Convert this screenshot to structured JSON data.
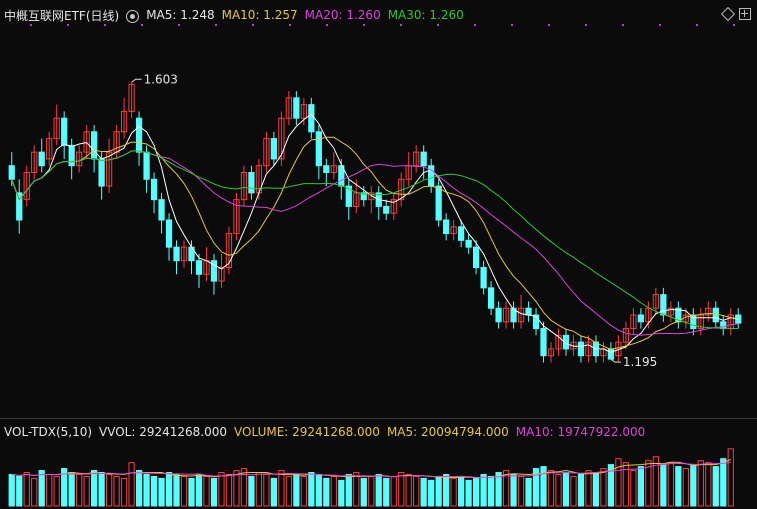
{
  "header": {
    "title": "中概互联网ETF(日线)",
    "ma5": "MA5: 1.248",
    "ma10": "MA10: 1.257",
    "ma20": "MA20: 1.260",
    "ma30": "MA30: 1.260"
  },
  "volume_header": {
    "title": "VOL-TDX(5,10)",
    "vvol": "VVOL: 29241268.000",
    "volume": "VOLUME: 29241268.000",
    "ma5": "MA5: 20094794.000",
    "ma10": "MA10: 19747922.000"
  },
  "annotations": {
    "high": "1.603",
    "low": "1.195"
  },
  "colors": {
    "up": "#ff3b3b",
    "down": "#54ffff",
    "ma5": "#ffffff",
    "ma10": "#e8c832",
    "ma20": "#e040e0",
    "ma30": "#2ec82e"
  },
  "icons": [
    "settings-gear-icon",
    "diamond-icon",
    "add-panel-icon"
  ],
  "chart_data": [
    {
      "type": "candlestick",
      "price_range": [
        1.12,
        1.68
      ],
      "high_label": 1.603,
      "low_label": 1.195,
      "candles": [
        [
          1.48,
          1.46,
          1.5,
          1.45
        ],
        [
          1.44,
          1.4,
          1.46,
          1.38
        ],
        [
          1.43,
          1.47,
          1.48,
          1.42
        ],
        [
          1.47,
          1.5,
          1.51,
          1.46
        ],
        [
          1.5,
          1.48,
          1.52,
          1.47
        ],
        [
          1.49,
          1.52,
          1.53,
          1.48
        ],
        [
          1.52,
          1.55,
          1.57,
          1.51
        ],
        [
          1.55,
          1.51,
          1.56,
          1.49
        ],
        [
          1.51,
          1.48,
          1.52,
          1.46
        ],
        [
          1.48,
          1.5,
          1.51,
          1.47
        ],
        [
          1.5,
          1.53,
          1.54,
          1.49
        ],
        [
          1.53,
          1.49,
          1.54,
          1.47
        ],
        [
          1.49,
          1.45,
          1.5,
          1.43
        ],
        [
          1.45,
          1.5,
          1.52,
          1.44
        ],
        [
          1.5,
          1.53,
          1.54,
          1.49
        ],
        [
          1.53,
          1.56,
          1.58,
          1.52
        ],
        [
          1.56,
          1.6,
          1.603,
          1.55
        ],
        [
          1.55,
          1.5,
          1.56,
          1.48
        ],
        [
          1.5,
          1.46,
          1.51,
          1.44
        ],
        [
          1.46,
          1.43,
          1.47,
          1.41
        ],
        [
          1.43,
          1.4,
          1.44,
          1.38
        ],
        [
          1.4,
          1.36,
          1.41,
          1.34
        ],
        [
          1.36,
          1.34,
          1.37,
          1.32
        ],
        [
          1.34,
          1.36,
          1.37,
          1.33
        ],
        [
          1.36,
          1.34,
          1.37,
          1.32
        ],
        [
          1.34,
          1.32,
          1.35,
          1.3
        ],
        [
          1.32,
          1.34,
          1.36,
          1.31
        ],
        [
          1.34,
          1.31,
          1.35,
          1.29
        ],
        [
          1.31,
          1.33,
          1.35,
          1.3
        ],
        [
          1.33,
          1.38,
          1.39,
          1.32
        ],
        [
          1.38,
          1.43,
          1.44,
          1.37
        ],
        [
          1.43,
          1.47,
          1.48,
          1.42
        ],
        [
          1.47,
          1.44,
          1.48,
          1.43
        ],
        [
          1.44,
          1.48,
          1.49,
          1.43
        ],
        [
          1.48,
          1.52,
          1.53,
          1.47
        ],
        [
          1.52,
          1.49,
          1.53,
          1.48
        ],
        [
          1.49,
          1.55,
          1.56,
          1.48
        ],
        [
          1.55,
          1.58,
          1.59,
          1.54
        ],
        [
          1.58,
          1.55,
          1.59,
          1.54
        ],
        [
          1.55,
          1.57,
          1.58,
          1.54
        ],
        [
          1.57,
          1.53,
          1.58,
          1.52
        ],
        [
          1.53,
          1.48,
          1.54,
          1.46
        ],
        [
          1.48,
          1.47,
          1.49,
          1.45
        ],
        [
          1.47,
          1.48,
          1.5,
          1.46
        ],
        [
          1.48,
          1.45,
          1.49,
          1.43
        ],
        [
          1.45,
          1.42,
          1.46,
          1.4
        ],
        [
          1.42,
          1.44,
          1.46,
          1.41
        ],
        [
          1.44,
          1.43,
          1.45,
          1.42
        ],
        [
          1.43,
          1.44,
          1.45,
          1.41
        ],
        [
          1.44,
          1.42,
          1.45,
          1.4
        ],
        [
          1.42,
          1.41,
          1.43,
          1.4
        ],
        [
          1.41,
          1.43,
          1.44,
          1.4
        ],
        [
          1.43,
          1.46,
          1.47,
          1.42
        ],
        [
          1.46,
          1.48,
          1.5,
          1.45
        ],
        [
          1.48,
          1.5,
          1.51,
          1.47
        ],
        [
          1.5,
          1.48,
          1.51,
          1.46
        ],
        [
          1.48,
          1.45,
          1.49,
          1.44
        ],
        [
          1.45,
          1.4,
          1.46,
          1.39
        ],
        [
          1.4,
          1.38,
          1.41,
          1.37
        ],
        [
          1.38,
          1.39,
          1.4,
          1.37
        ],
        [
          1.39,
          1.37,
          1.4,
          1.36
        ],
        [
          1.37,
          1.36,
          1.38,
          1.35
        ],
        [
          1.36,
          1.33,
          1.37,
          1.32
        ],
        [
          1.33,
          1.3,
          1.34,
          1.29
        ],
        [
          1.3,
          1.27,
          1.31,
          1.26
        ],
        [
          1.27,
          1.25,
          1.28,
          1.24
        ],
        [
          1.25,
          1.27,
          1.28,
          1.24
        ],
        [
          1.27,
          1.25,
          1.28,
          1.24
        ],
        [
          1.25,
          1.27,
          1.29,
          1.24
        ],
        [
          1.27,
          1.26,
          1.28,
          1.25
        ],
        [
          1.26,
          1.24,
          1.27,
          1.23
        ],
        [
          1.24,
          1.2,
          1.25,
          1.19
        ],
        [
          1.2,
          1.21,
          1.22,
          1.19
        ],
        [
          1.21,
          1.23,
          1.24,
          1.2
        ],
        [
          1.23,
          1.21,
          1.24,
          1.2
        ],
        [
          1.21,
          1.22,
          1.23,
          1.2
        ],
        [
          1.22,
          1.2,
          1.23,
          1.19
        ],
        [
          1.2,
          1.22,
          1.23,
          1.19
        ],
        [
          1.22,
          1.2,
          1.23,
          1.19
        ],
        [
          1.2,
          1.21,
          1.22,
          1.19
        ],
        [
          1.21,
          1.195,
          1.22,
          1.195
        ],
        [
          1.2,
          1.22,
          1.23,
          1.19
        ],
        [
          1.22,
          1.24,
          1.25,
          1.21
        ],
        [
          1.24,
          1.26,
          1.27,
          1.23
        ],
        [
          1.26,
          1.25,
          1.27,
          1.24
        ],
        [
          1.25,
          1.27,
          1.28,
          1.24
        ],
        [
          1.27,
          1.29,
          1.3,
          1.26
        ],
        [
          1.29,
          1.26,
          1.3,
          1.25
        ],
        [
          1.26,
          1.27,
          1.28,
          1.25
        ],
        [
          1.27,
          1.25,
          1.28,
          1.24
        ],
        [
          1.25,
          1.26,
          1.27,
          1.24
        ],
        [
          1.26,
          1.24,
          1.27,
          1.23
        ],
        [
          1.24,
          1.26,
          1.27,
          1.23
        ],
        [
          1.26,
          1.27,
          1.28,
          1.25
        ],
        [
          1.27,
          1.25,
          1.28,
          1.24
        ],
        [
          1.25,
          1.24,
          1.26,
          1.23
        ],
        [
          1.24,
          1.26,
          1.27,
          1.23
        ],
        [
          1.26,
          1.248,
          1.27,
          1.24
        ]
      ],
      "ma_labels": [
        "MA5",
        "MA10",
        "MA20",
        "MA30"
      ]
    },
    {
      "type": "bar",
      "title": "VOL-TDX(5,10)",
      "volumes": [
        16,
        15,
        17,
        14,
        18,
        16,
        15,
        19,
        17,
        16,
        15,
        18,
        17,
        16,
        15,
        14,
        22,
        18,
        16,
        15,
        14,
        17,
        16,
        15,
        14,
        16,
        15,
        14,
        17,
        16,
        18,
        19,
        15,
        17,
        16,
        14,
        18,
        15,
        16,
        15,
        17,
        16,
        14,
        15,
        13,
        16,
        17,
        14,
        15,
        16,
        14,
        15,
        17,
        16,
        15,
        14,
        13,
        15,
        16,
        14,
        15,
        13,
        14,
        16,
        15,
        17,
        18,
        16,
        15,
        14,
        19,
        20,
        18,
        16,
        17,
        15,
        16,
        18,
        17,
        19,
        21,
        24,
        22,
        18,
        20,
        23,
        25,
        21,
        22,
        20,
        19,
        21,
        23,
        22,
        20,
        24,
        29
      ],
      "ma_labels": [
        "MA5",
        "MA10"
      ]
    }
  ]
}
